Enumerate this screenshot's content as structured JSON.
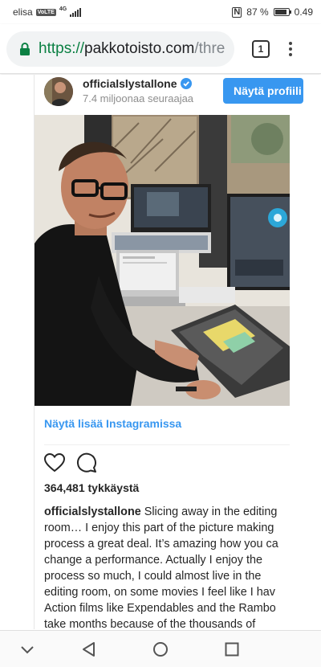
{
  "status_bar": {
    "carrier": "elisa",
    "volte": "VoLTE",
    "network": "4G",
    "battery_text": "87 %",
    "battery_level": 0.87,
    "time": "0.49"
  },
  "browser": {
    "url_scheme": "https://",
    "url_host": "pakkotoisto.com",
    "url_path": "/threads",
    "tab_count": "1",
    "secure_color": "#0b8043"
  },
  "instagram": {
    "username": "officialslystallone",
    "followers": "7.4 miljoonaa seuraajaa",
    "view_profile_label": "Näytä profiili",
    "view_more_label": "Näytä lisää Instagramissa",
    "likes": "364,481 tykkäystä",
    "caption_user": "officialslystallone",
    "caption_lines": [
      " Slicing away in the editing",
      "room… I enjoy this part of the picture making",
      "process a great deal. It’s amazing how you ca",
      "change a performance. Actually I enjoy the",
      "process so much, I could almost live in the",
      "editing room, on some movies I feel like I hav",
      "Action films like Expendables and the Rambo",
      "take months because of the thousands of"
    ],
    "accent_color": "#3897f0"
  },
  "nav": {
    "icons": [
      "chevron-down-icon",
      "back-triangle-icon",
      "home-circle-icon",
      "recents-square-icon"
    ]
  }
}
